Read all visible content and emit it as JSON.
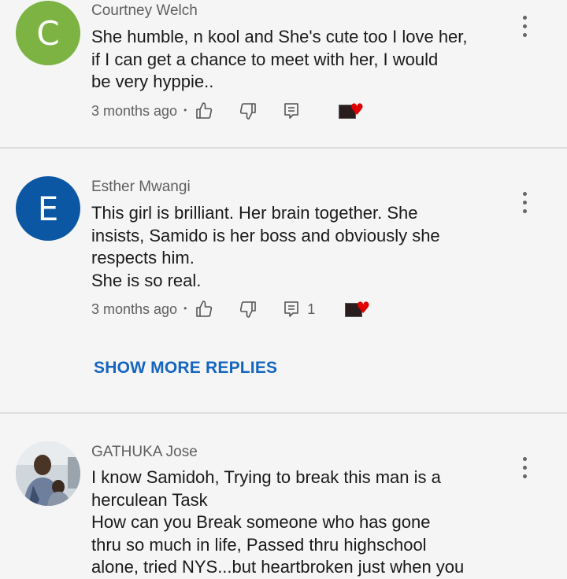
{
  "comments": [
    {
      "author": "Courtney Welch",
      "avatar_letter": "C",
      "avatar_color": "#7cb342",
      "lines": [
        "She humble, n kool and She's cute too I love her,",
        "if I can get a chance to meet with her, I would",
        "be very hyppie.."
      ],
      "time": "3 months ago"
    },
    {
      "author": "Esther Mwangi",
      "avatar_letter": "E",
      "avatar_color": "#0b57a4",
      "lines": [
        "This girl is brilliant.  Her brain together. She",
        "insists, Samido is her boss and obviously she",
        "respects him.",
        "She is so real."
      ],
      "time": "3 months ago",
      "reply_count": "1",
      "show_more_label": "SHOW MORE REPLIES"
    },
    {
      "author": "GATHUKA Jose",
      "avatar": "photo",
      "lines": [
        "I know Samidoh, Trying to break this man is a",
        "herculean Task",
        "How can you Break someone who has gone",
        "thru so much in life, Passed thru highschool",
        "alone, tried NYS...but heartbroken just when you"
      ]
    }
  ],
  "icons": [
    "like-icon",
    "dislike-icon",
    "reply-icon",
    "creator-heart-icon",
    "more-options-icon"
  ],
  "colors": {
    "link": "#1565c0",
    "heart": "#e00000",
    "background": "#f5f5f5"
  }
}
